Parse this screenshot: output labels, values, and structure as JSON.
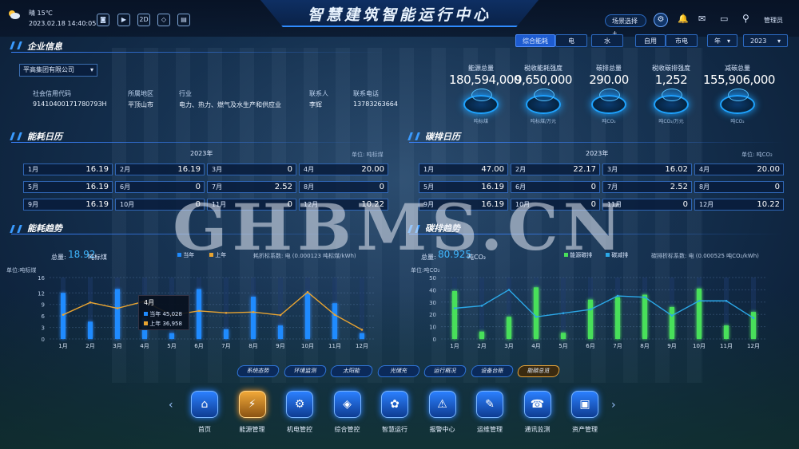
{
  "header": {
    "weather": "晴 15℃",
    "datetime": "2023.02.18 14:40:05",
    "title": "智慧建筑智能运行中心",
    "scene_select": "场景选择+",
    "user": "管理员"
  },
  "filters": {
    "energy_tabs": [
      "综合能耗",
      "电",
      "水"
    ],
    "use_tabs": [
      "自用",
      "市电"
    ],
    "period": "年",
    "year": "2023"
  },
  "company": {
    "section_title": "企业信息",
    "select_value": "平高集团有限公司",
    "fields": [
      {
        "label": "社会信用代码",
        "value": "91410400171780793H"
      },
      {
        "label": "所属地区",
        "value": "平顶山市"
      },
      {
        "label": "行业",
        "value": "电力、热力、燃气及水生产和供应业"
      },
      {
        "label": "联系人",
        "value": "李辉"
      },
      {
        "label": "联系电话",
        "value": "13783263664"
      }
    ]
  },
  "stats": [
    {
      "title": "能源总量",
      "value": "180,594,000",
      "unit": "吨标煤"
    },
    {
      "title": "税收能耗强度",
      "value": "9,650,000",
      "unit": "吨标煤/万元"
    },
    {
      "title": "碳排总量",
      "value": "290.00",
      "unit": "吨CO₂"
    },
    {
      "title": "税收碳排强度",
      "value": "1,252",
      "unit": "吨CO₂/万元"
    },
    {
      "title": "减碳总量",
      "value": "155,906,000",
      "unit": "吨CO₂"
    }
  ],
  "energy_calendar": {
    "section_title": "能耗日历",
    "year": "2023年",
    "unit": "单位: 吨标煤",
    "cells": [
      {
        "month": "1月",
        "value": "16.19"
      },
      {
        "month": "2月",
        "value": "16.19"
      },
      {
        "month": "3月",
        "value": "0"
      },
      {
        "month": "4月",
        "value": "20.00"
      },
      {
        "month": "5月",
        "value": "16.19"
      },
      {
        "month": "6月",
        "value": "0"
      },
      {
        "month": "7月",
        "value": "2.52"
      },
      {
        "month": "8月",
        "value": "0"
      },
      {
        "month": "9月",
        "value": "16.19"
      },
      {
        "month": "10月",
        "value": "0"
      },
      {
        "month": "11月",
        "value": "0"
      },
      {
        "month": "12月",
        "value": "10.22"
      }
    ]
  },
  "carbon_calendar": {
    "section_title": "碳排日历",
    "year": "2023年",
    "unit": "单位: 吨CO₂",
    "cells": [
      {
        "month": "1月",
        "value": "47.00"
      },
      {
        "month": "2月",
        "value": "22.17"
      },
      {
        "month": "3月",
        "value": "16.02"
      },
      {
        "month": "4月",
        "value": "20.00"
      },
      {
        "month": "5月",
        "value": "16.19"
      },
      {
        "month": "6月",
        "value": "0"
      },
      {
        "month": "7月",
        "value": "2.52"
      },
      {
        "month": "8月",
        "value": "0"
      },
      {
        "month": "9月",
        "value": "16.19"
      },
      {
        "month": "10月",
        "value": "0"
      },
      {
        "month": "11月",
        "value": "0"
      },
      {
        "month": "12月",
        "value": "10.22"
      }
    ]
  },
  "energy_trend": {
    "section_title": "能耗趋势",
    "total_label": "总量:",
    "total_value": "18.92",
    "total_unit": "吨标煤",
    "legend": [
      "当年",
      "上年"
    ],
    "factor": "耗折标系数: 电 (0.000123 吨标煤/kWh)",
    "unit": "单位:吨标煤",
    "tooltip": {
      "title": "4月",
      "current": "当年 45,028",
      "last": "上年 36,958"
    }
  },
  "carbon_trend": {
    "section_title": "碳排趋势",
    "total_label": "总量:",
    "total_value": "80.925",
    "total_unit": "吨CO₂",
    "legend": [
      "能源碳排",
      "碳减排"
    ],
    "factor": "碳排折标系数: 电 (0.000525 吨CO₂/kWh)",
    "unit": "单位:吨CO₂"
  },
  "chart_data": [
    {
      "type": "bar",
      "title": "能耗趋势",
      "ylabel": "单位:吨标煤",
      "ylim": [
        0,
        16
      ],
      "yticks": [
        0,
        3,
        6,
        9,
        12,
        16
      ],
      "categories": [
        "1月",
        "2月",
        "3月",
        "4月",
        "5月",
        "6月",
        "7月",
        "8月",
        "9月",
        "10月",
        "11月",
        "12月"
      ],
      "series": [
        {
          "name": "当年",
          "type": "bar",
          "values": [
            12,
            4.5,
            13,
            5.5,
            1.5,
            13,
            2.5,
            11,
            3.5,
            12,
            9.3,
            1.5
          ]
        },
        {
          "name": "上年",
          "type": "line",
          "values": [
            6.3,
            9.5,
            8,
            9.8,
            6.2,
            7.3,
            6.8,
            7,
            6.2,
            12.2,
            6.3,
            2.4
          ]
        }
      ]
    },
    {
      "type": "bar",
      "title": "碳排趋势",
      "ylabel": "单位:吨CO₂",
      "ylim": [
        0,
        50
      ],
      "yticks": [
        0,
        10,
        20,
        30,
        40,
        50
      ],
      "categories": [
        "1月",
        "2月",
        "3月",
        "4月",
        "5月",
        "6月",
        "7月",
        "8月",
        "9月",
        "10月",
        "11月",
        "12月"
      ],
      "series": [
        {
          "name": "能源碳排",
          "type": "bar",
          "values": [
            39,
            6,
            18,
            42,
            5,
            32,
            34,
            36,
            26,
            41,
            11,
            22
          ]
        },
        {
          "name": "碳减排",
          "type": "line",
          "values": [
            25,
            27,
            40,
            18,
            21,
            24,
            35,
            34,
            19,
            31,
            31,
            17
          ]
        }
      ]
    }
  ],
  "nav_tags": [
    "系统态势",
    "环境监测",
    "太阳能",
    "光储充",
    "运行概况",
    "设备台账",
    "能碳总览"
  ],
  "nav_items": [
    "首页",
    "能源管理",
    "机电管控",
    "综合管控",
    "智慧运行",
    "报警中心",
    "运维管理",
    "通讯监测",
    "资产管理"
  ],
  "watermark": "GHBMS.CN",
  "colors": {
    "accent": "#2f8cff",
    "bar_energy": "#1f8bff",
    "line_last": "#e9a431",
    "bar_carbon": "#48e05a",
    "line_reduce": "#2ba8e8"
  }
}
